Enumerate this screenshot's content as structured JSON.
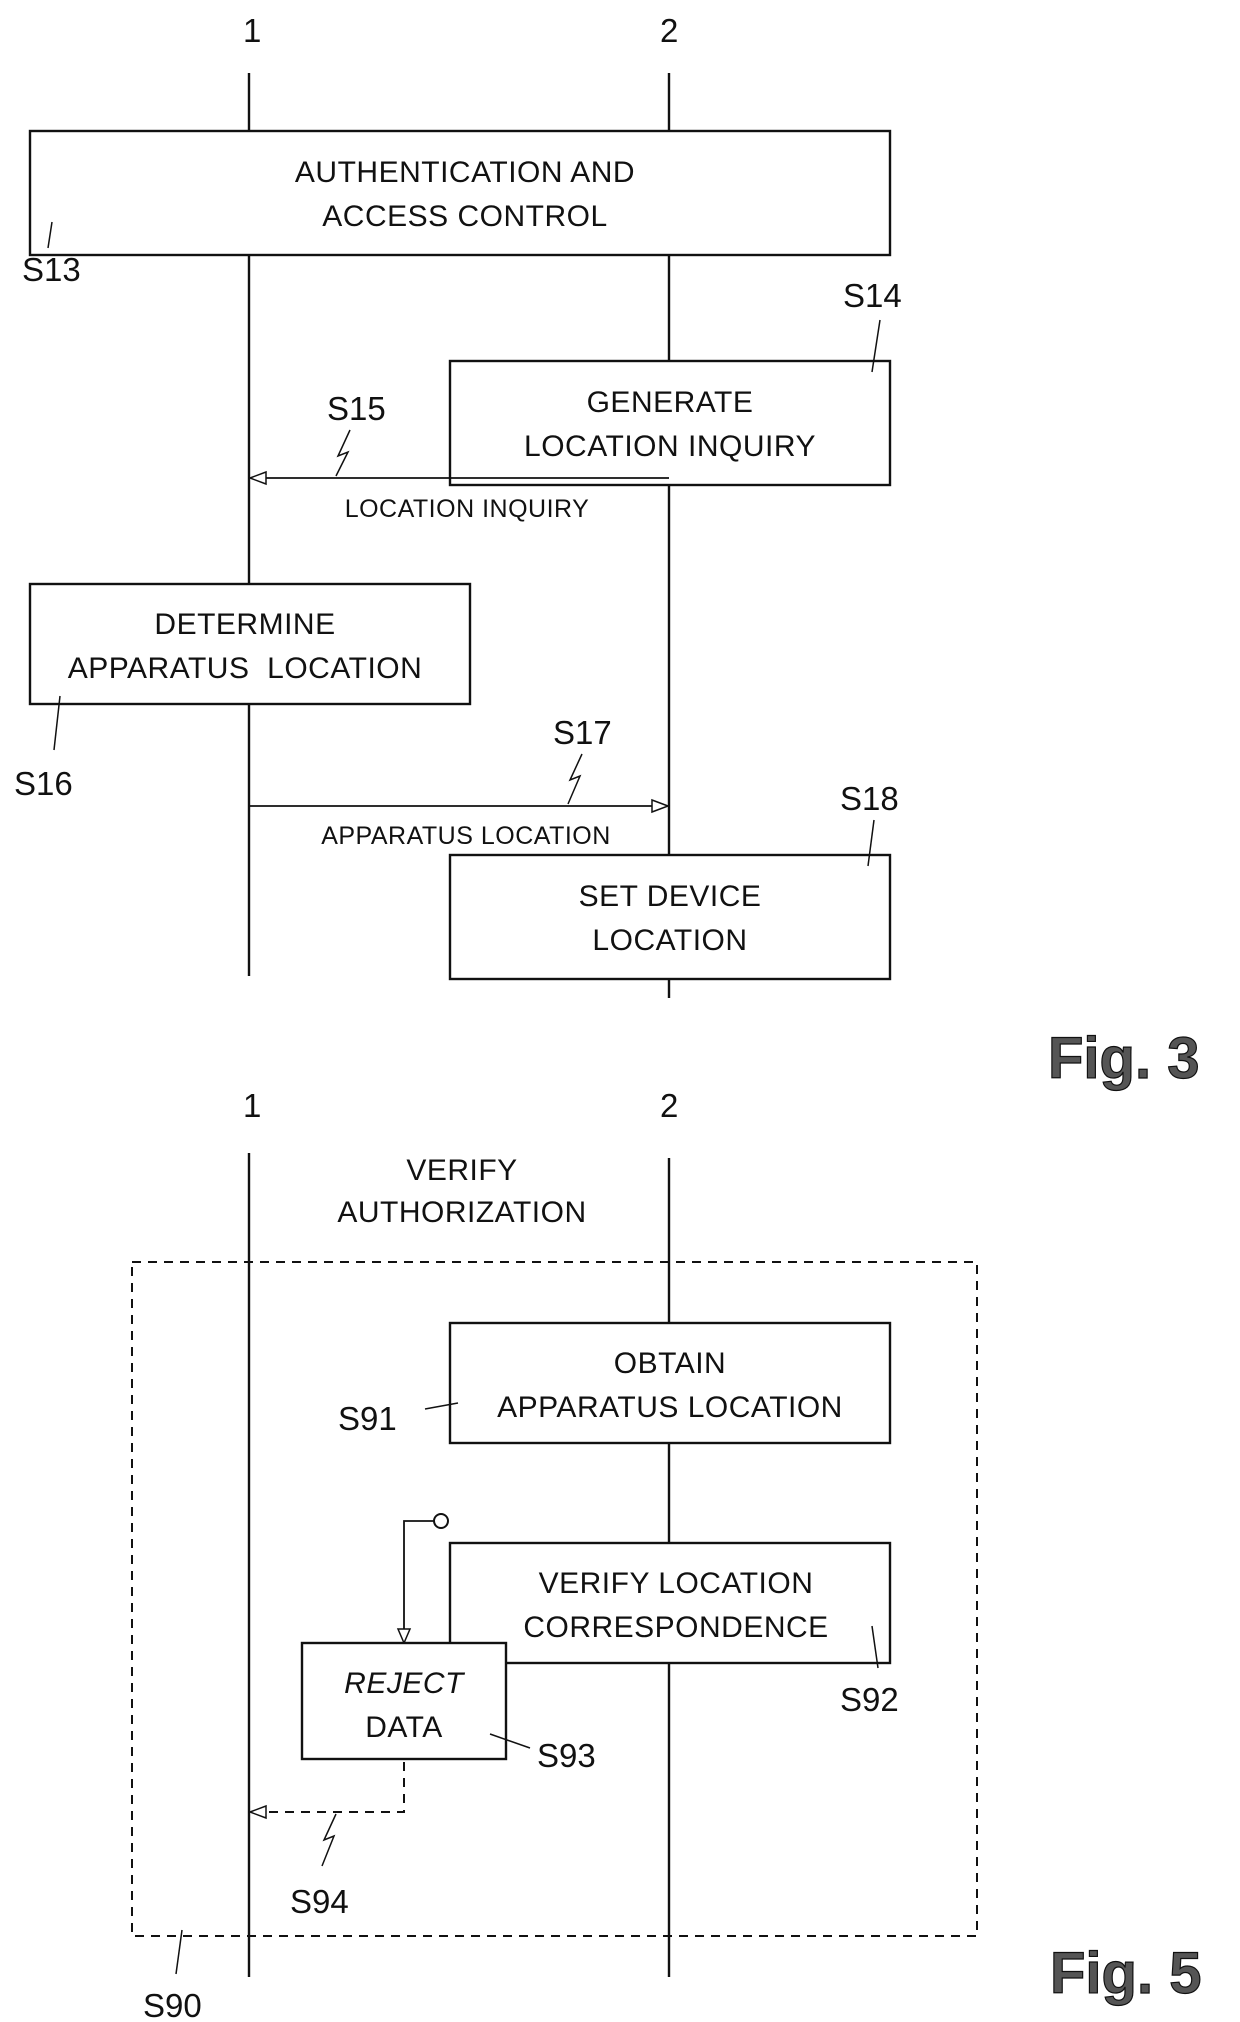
{
  "figures": [
    {
      "caption": "Fig. 3",
      "lifelines": [
        {
          "label": "1"
        },
        {
          "label": "2"
        }
      ],
      "steps": {
        "s13": {
          "ref": "S13",
          "lines": [
            "AUTHENTICATION AND",
            "ACCESS CONTROL"
          ]
        },
        "s14": {
          "ref": "S14",
          "lines": [
            "GENERATE",
            "LOCATION INQUIRY"
          ]
        },
        "s15": {
          "ref": "S15",
          "message": "LOCATION INQUIRY",
          "direction": "2 → 1"
        },
        "s16": {
          "ref": "S16",
          "lines": [
            "DETERMINE",
            "APPARATUS  LOCATION"
          ]
        },
        "s17": {
          "ref": "S17",
          "message": "APPARATUS LOCATION",
          "direction": "1 → 2"
        },
        "s18": {
          "ref": "S18",
          "lines": [
            "SET DEVICE",
            "LOCATION"
          ]
        }
      }
    },
    {
      "caption": "Fig. 5",
      "lifelines": [
        {
          "label": "1"
        },
        {
          "label": "2"
        }
      ],
      "group": {
        "ref": "S90",
        "lines": [
          "VERIFY",
          "AUTHORIZATION"
        ]
      },
      "steps": {
        "s91": {
          "ref": "S91",
          "lines": [
            "OBTAIN",
            "APPARATUS LOCATION"
          ]
        },
        "s92": {
          "ref": "S92",
          "lines": [
            "VERIFY LOCATION",
            "CORRESPONDENCE"
          ]
        },
        "s93": {
          "ref": "S93",
          "lines": [
            "REJECT",
            "DATA"
          ]
        },
        "s94": {
          "ref": "S94",
          "direction": "to 1"
        }
      }
    }
  ]
}
